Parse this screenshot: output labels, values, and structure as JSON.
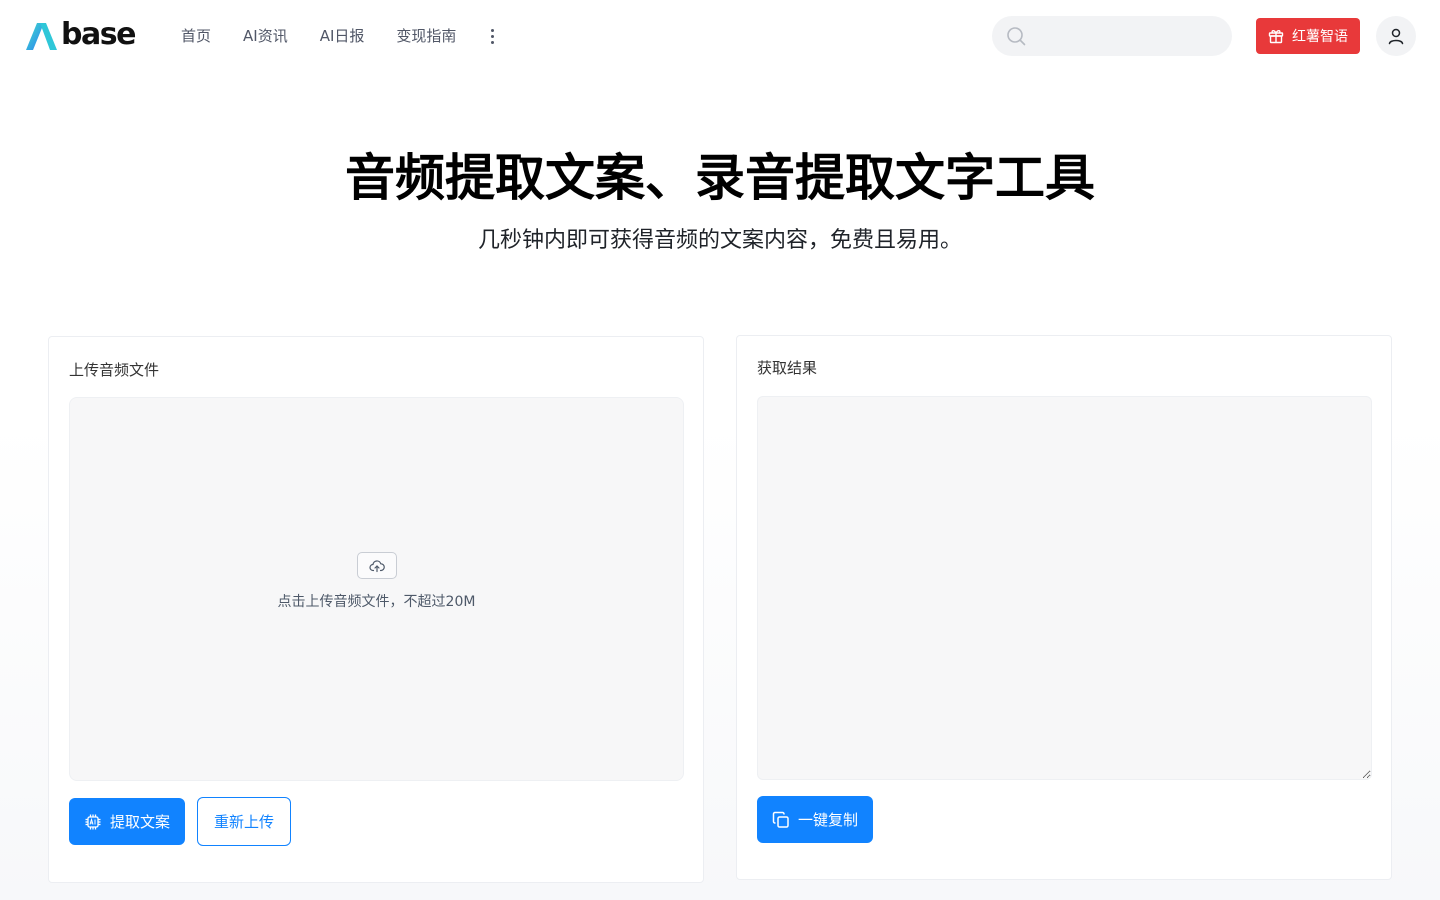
{
  "header": {
    "logo_text": "base",
    "nav": [
      "首页",
      "AI资讯",
      "AI日报",
      "变现指南"
    ],
    "search_placeholder": "",
    "promo_label": "红薯智语"
  },
  "hero": {
    "title": "音频提取文案、录音提取文字工具",
    "subtitle": "几秒钟内即可获得音频的文案内容，免费且易用。"
  },
  "upload_panel": {
    "label": "上传音频文件",
    "upload_hint": "点击上传音频文件，不超过20M",
    "extract_button": "提取文案",
    "reupload_button": "重新上传"
  },
  "result_panel": {
    "label": "获取结果",
    "result_text": "",
    "copy_button": "一键复制"
  },
  "colors": {
    "primary": "#1183ff",
    "promo": "#e8393a",
    "logo_gradient": [
      "#3fd3c5",
      "#2f7cf6"
    ]
  }
}
